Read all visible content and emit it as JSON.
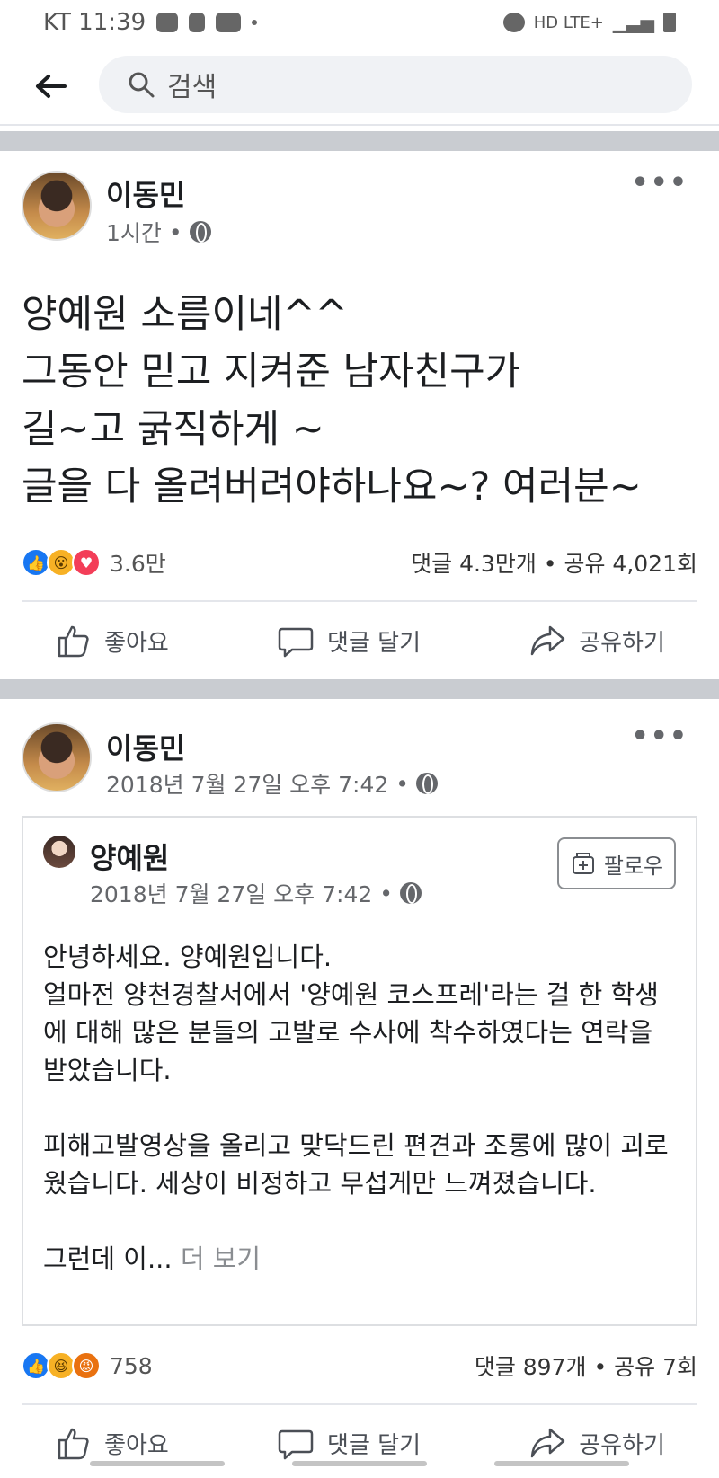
{
  "status_bar": {
    "carrier_time": "KT 11:39",
    "network": "HD LTE+"
  },
  "search": {
    "placeholder": "검색"
  },
  "posts": [
    {
      "author": "이동민",
      "time": "1시간",
      "text": "양예원 소름이네^^\n그동안 믿고 지켜준 남자친구가\n길~고 굵직하게 ~\n글을 다 올려버려야하나요~? 여러분~",
      "reaction_count": "3.6만",
      "comments_shares": "댓글 4.3만개 • 공유 4,021회",
      "actions": {
        "like": "좋아요",
        "comment": "댓글 달기",
        "share": "공유하기"
      }
    },
    {
      "author": "이동민",
      "time": "2018년 7월 27일 오후 7:42",
      "shared": {
        "author": "양예원",
        "time": "2018년 7월 27일 오후 7:42",
        "follow_label": "팔로우",
        "body": "안녕하세요. 양예원입니다.\n얼마전 양천경찰서에서 '양예원 코스프레'라는 걸 한 학생에 대해 많은 분들의 고발로 수사에 착수하였다는 연락을 받았습니다.\n\n피해고발영상을 올리고 맞닥드린 편견과 조롱에 많이 괴로웠습니다. 세상이 비정하고 무섭게만 느껴졌습니다.\n\n",
        "truncated_text": "그런데 이...",
        "see_more": "더 보기"
      },
      "reaction_count": "758",
      "comments_shares": "댓글 897개 • 공유 7회",
      "actions": {
        "like": "좋아요",
        "comment": "댓글 달기",
        "share": "공유하기"
      }
    }
  ],
  "colors": {
    "accent": "#1877f2",
    "separator": "#c9ccd1",
    "muted_text": "#65676b"
  }
}
